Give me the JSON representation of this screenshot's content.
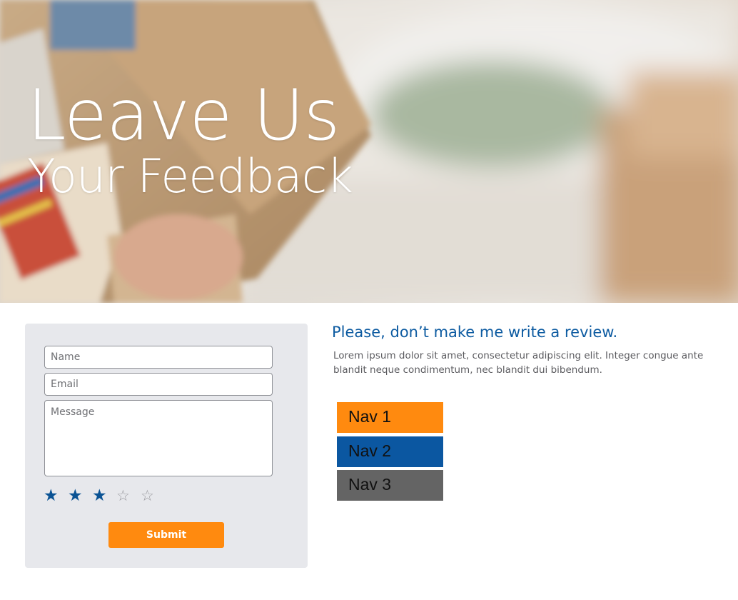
{
  "hero": {
    "title_line1": "Leave Us",
    "title_line2": "Your Feedback"
  },
  "form": {
    "name_placeholder": "Name",
    "email_placeholder": "Email",
    "message_placeholder": "Message",
    "rating": {
      "value": 3,
      "max": 5,
      "filled_glyph": "★",
      "empty_glyph": "☆",
      "filled_color": "#0b5394",
      "empty_color": "#9b9ba0"
    },
    "submit_label": "Submit",
    "submit_color": "#ff8a0f"
  },
  "review": {
    "heading": "Please, don’t make me write a review.",
    "body": "Lorem ipsum dolor sit amet, consectetur adipiscing elit. Integer congue ante blandit neque condimentum, nec blandit dui bibendum."
  },
  "nav": [
    {
      "label": "Nav 1",
      "color": "#ff8a0f"
    },
    {
      "label": "Nav 2",
      "color": "#0b57a1"
    },
    {
      "label": "Nav 3",
      "color": "#646464"
    }
  ]
}
